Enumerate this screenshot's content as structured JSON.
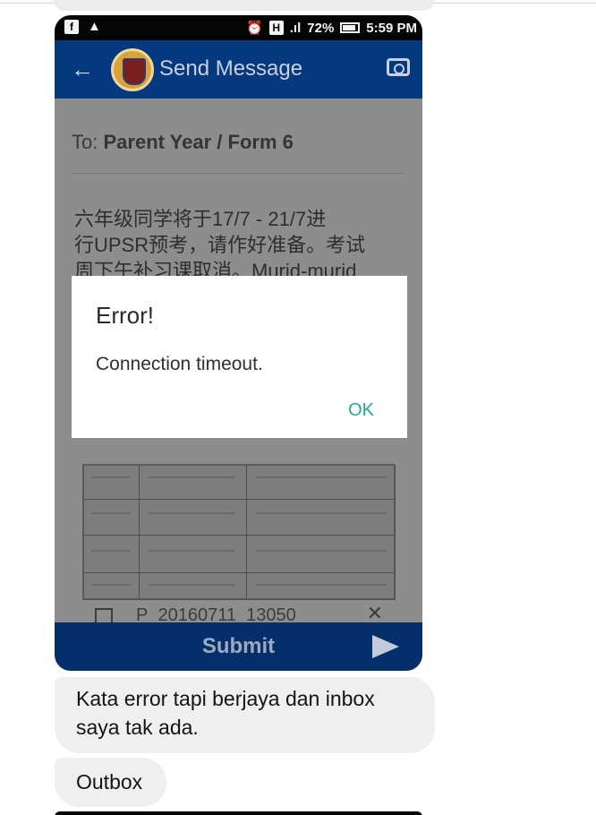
{
  "status_bar": {
    "left_icons": [
      "facebook-icon",
      "warning-icon"
    ],
    "battery": "72%",
    "time": "5:59 PM"
  },
  "app_bar": {
    "back_icon": "back-arrow-icon",
    "title": "Send Message",
    "camera_icon": "camera-icon"
  },
  "form": {
    "to_prefix": "To:",
    "to_value": "Parent Year / Form 6",
    "message_lines": [
      "六年级同学将于17/7 - 21/7进",
      "行UPSR预考，请作好准备。考试",
      "周下午补习课取消。Murid-murid"
    ],
    "attachment_name": "P_20160711_13050",
    "attachment_icon": "image-icon",
    "attachment_close": "✕"
  },
  "submit": {
    "label": "Submit",
    "icon": "send-icon"
  },
  "dialog": {
    "title": "Error!",
    "message": "Connection timeout.",
    "ok": "OK"
  },
  "chat": {
    "bubble_1": "Kata error tapi berjaya dan inbox saya tak ada.",
    "bubble_2": "Outbox"
  },
  "colors": {
    "app_bar": "#05397f",
    "submit_bar": "#052f6b",
    "dialog_ok": "#2aa397",
    "bubble": "#efefef"
  }
}
